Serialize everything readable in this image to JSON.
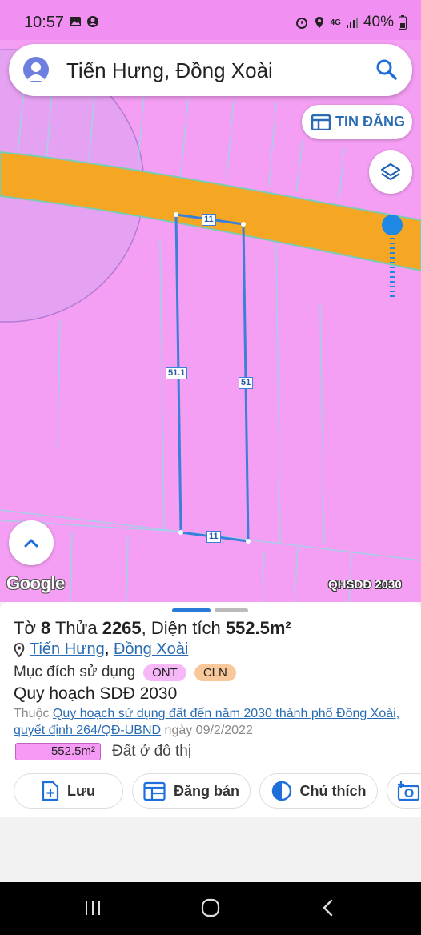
{
  "status_bar": {
    "time": "10:57",
    "battery": "40%",
    "network": "4G"
  },
  "search": {
    "query": "Tiến Hưng, Đồng Xoài"
  },
  "map": {
    "post_button_label": "TIN ĐĂNG",
    "google_label": "Google",
    "layer_badge": "QHSDĐ 2030",
    "edge_labels": {
      "top": "11",
      "left": "51.1",
      "right": "51",
      "bottom": "11"
    },
    "colors": {
      "residential": "#f49ff4",
      "road": "#f5a623",
      "parcel_outline": "#3a7fd8"
    }
  },
  "sheet": {
    "title_prefix": "Tờ ",
    "sheet_no": "8",
    "title_mid": " Thửa ",
    "parcel_no": "2265",
    "title_suffix": ", Diện tích ",
    "area": "552.5m²",
    "location_ward": "Tiến Hưng",
    "location_sep": ", ",
    "location_city": "Đồng Xoài",
    "purpose_label": "Mục đích sử dụng",
    "purpose_chips": [
      {
        "code": "ONT",
        "color": "#f7b8f7"
      },
      {
        "code": "CLN",
        "color": "#f8c79a"
      }
    ],
    "plan_title": "Quy hoạch SDĐ 2030",
    "plan_prefix": "Thuộc ",
    "plan_link": "Quy hoạch sử dụng đất đến năm 2030 thành phố Đồng Xoài, quyết định 264/QĐ-UBND",
    "plan_date": " ngày 09/2/2022",
    "zone_area": "552.5m²",
    "zone_label": "Đất ở đô thị",
    "actions": [
      {
        "label": "Lưu",
        "icon": "save-file-icon"
      },
      {
        "label": "Đăng bán",
        "icon": "calendar-post-icon"
      },
      {
        "label": "Chú thích",
        "icon": "legend-icon"
      }
    ]
  }
}
